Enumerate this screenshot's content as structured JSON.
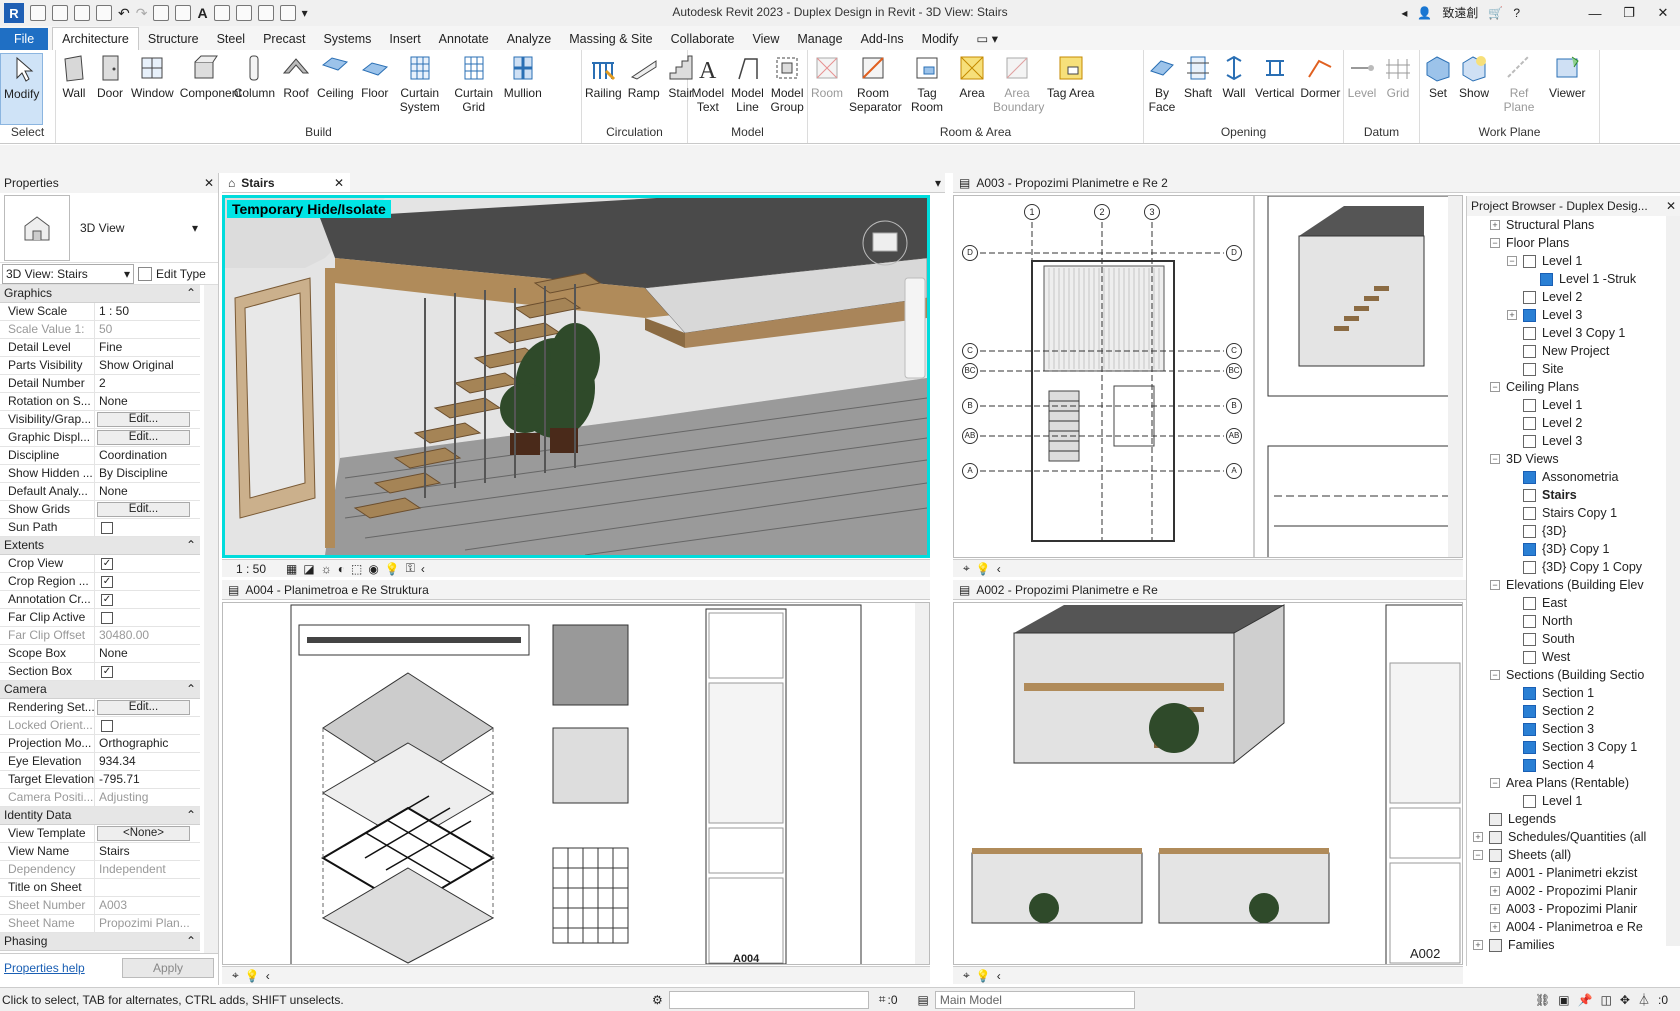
{
  "app": {
    "title": "Autodesk Revit 2023 - Duplex Design in Revit - 3D View: Stairs",
    "user": "致遠創"
  },
  "tabs": [
    "File",
    "Architecture",
    "Structure",
    "Steel",
    "Precast",
    "Systems",
    "Insert",
    "Annotate",
    "Analyze",
    "Massing & Site",
    "Collaborate",
    "View",
    "Manage",
    "Add-Ins",
    "Modify"
  ],
  "ribbon": {
    "panels": [
      {
        "label": "Select",
        "tools": [
          "Modify"
        ]
      },
      {
        "label": "Build",
        "tools": [
          "Wall",
          "Door",
          "Window",
          "Component",
          "Column",
          "Roof",
          "Ceiling",
          "Floor",
          "Curtain System",
          "Curtain Grid",
          "Mullion"
        ]
      },
      {
        "label": "Circulation",
        "tools": [
          "Railing",
          "Ramp",
          "Stair"
        ]
      },
      {
        "label": "Model",
        "tools": [
          "Model Text",
          "Model Line",
          "Model Group"
        ]
      },
      {
        "label": "Room & Area",
        "tools": [
          "Room",
          "Room Separator",
          "Tag Room",
          "Area",
          "Area Boundary",
          "Tag Area"
        ]
      },
      {
        "label": "Opening",
        "tools": [
          "By Face",
          "Shaft",
          "Wall",
          "Vertical",
          "Dormer"
        ]
      },
      {
        "label": "Datum",
        "tools": [
          "Level",
          "Grid"
        ]
      },
      {
        "label": "Work Plane",
        "tools": [
          "Set",
          "Show",
          "Ref Plane",
          "Viewer"
        ]
      }
    ]
  },
  "properties": {
    "header": "Properties",
    "type": "3D View",
    "selector": "3D View: Stairs",
    "edit_type": "Edit Type",
    "sections": [
      {
        "name": "Graphics",
        "rows": [
          [
            "View Scale",
            "1 : 50",
            ""
          ],
          [
            "Scale Value 1:",
            "50",
            "ro"
          ],
          [
            "Detail Level",
            "Fine",
            ""
          ],
          [
            "Parts Visibility",
            "Show Original",
            ""
          ],
          [
            "Detail Number",
            "2",
            ""
          ],
          [
            "Rotation on S...",
            "None",
            ""
          ],
          [
            "Visibility/Grap...",
            "Edit...",
            "btn"
          ],
          [
            "Graphic Displ...",
            "Edit...",
            "btn"
          ],
          [
            "Discipline",
            "Coordination",
            ""
          ],
          [
            "Show Hidden ...",
            "By Discipline",
            ""
          ],
          [
            "Default Analy...",
            "None",
            ""
          ],
          [
            "Show Grids",
            "Edit...",
            "btn"
          ],
          [
            "Sun Path",
            "",
            "cb0"
          ]
        ]
      },
      {
        "name": "Extents",
        "rows": [
          [
            "Crop View",
            "",
            "cb1"
          ],
          [
            "Crop Region ...",
            "",
            "cb1"
          ],
          [
            "Annotation Cr...",
            "",
            "cb1"
          ],
          [
            "Far Clip Active",
            "",
            "cb0"
          ],
          [
            "Far Clip Offset",
            "30480.00",
            "ro"
          ],
          [
            "Scope Box",
            "None",
            ""
          ],
          [
            "Section Box",
            "",
            "cb1"
          ]
        ]
      },
      {
        "name": "Camera",
        "rows": [
          [
            "Rendering Set...",
            "Edit...",
            "btn"
          ],
          [
            "Locked Orient...",
            "",
            "cb0ro"
          ],
          [
            "Projection Mo...",
            "Orthographic",
            ""
          ],
          [
            "Eye Elevation",
            "934.34",
            ""
          ],
          [
            "Target Elevation",
            "-795.71",
            ""
          ],
          [
            "Camera Positi...",
            "Adjusting",
            "ro"
          ]
        ]
      },
      {
        "name": "Identity Data",
        "rows": [
          [
            "View Template",
            "<None>",
            "btn"
          ],
          [
            "View Name",
            "Stairs",
            ""
          ],
          [
            "Dependency",
            "Independent",
            "ro"
          ],
          [
            "Title on Sheet",
            "",
            ""
          ],
          [
            "Sheet Number",
            "A003",
            "ro"
          ],
          [
            "Sheet Name",
            "Propozimi Plan...",
            "ro"
          ]
        ]
      },
      {
        "name": "Phasing",
        "rows": []
      }
    ],
    "help": "Properties help",
    "apply": "Apply"
  },
  "views": {
    "v1": {
      "tab": "Stairs",
      "banner": "Temporary Hide/Isolate",
      "scale": "1 : 50"
    },
    "v2": {
      "tab": "A003 - Propozimi Planimetre e Re 2"
    },
    "v3": {
      "tab": "A004 - Planimetroa e Re Struktura",
      "sheet": "A004"
    },
    "v4": {
      "tab": "A002 - Propozimi Planimetre e Re",
      "sheet": "A002"
    }
  },
  "grid_labels": {
    "cols": [
      "1",
      "2",
      "3"
    ],
    "rows": [
      "D",
      "C",
      "BC",
      "B",
      "AB",
      "A"
    ]
  },
  "browser": {
    "title": "Project Browser - Duplex Desig...",
    "items": [
      [
        1,
        "+",
        "",
        "Structural Plans"
      ],
      [
        1,
        "-",
        "",
        "Floor Plans"
      ],
      [
        2,
        "-",
        "w",
        "Level 1"
      ],
      [
        3,
        "",
        "b",
        "Level 1 -Struk"
      ],
      [
        2,
        "",
        "w",
        "Level 2"
      ],
      [
        2,
        "+",
        "b",
        "Level 3"
      ],
      [
        2,
        "",
        "w",
        "Level 3 Copy 1"
      ],
      [
        2,
        "",
        "w",
        "New Project"
      ],
      [
        2,
        "",
        "w",
        "Site"
      ],
      [
        1,
        "-",
        "",
        "Ceiling Plans"
      ],
      [
        2,
        "",
        "w",
        "Level 1"
      ],
      [
        2,
        "",
        "w",
        "Level 2"
      ],
      [
        2,
        "",
        "w",
        "Level 3"
      ],
      [
        1,
        "-",
        "",
        "3D Views"
      ],
      [
        2,
        "",
        "b",
        "Assonometria"
      ],
      [
        2,
        "",
        "w",
        "Stairs"
      ],
      [
        2,
        "",
        "w",
        "Stairs Copy 1"
      ],
      [
        2,
        "",
        "w",
        "{3D}"
      ],
      [
        2,
        "",
        "b",
        "{3D} Copy 1"
      ],
      [
        2,
        "",
        "w",
        "{3D} Copy 1 Copy"
      ],
      [
        1,
        "-",
        "",
        "Elevations (Building Elev"
      ],
      [
        2,
        "",
        "w",
        "East"
      ],
      [
        2,
        "",
        "w",
        "North"
      ],
      [
        2,
        "",
        "w",
        "South"
      ],
      [
        2,
        "",
        "w",
        "West"
      ],
      [
        1,
        "-",
        "",
        "Sections (Building Sectio"
      ],
      [
        2,
        "",
        "b",
        "Section 1"
      ],
      [
        2,
        "",
        "b",
        "Section 2"
      ],
      [
        2,
        "",
        "b",
        "Section 3"
      ],
      [
        2,
        "",
        "b",
        "Section 3 Copy 1"
      ],
      [
        2,
        "",
        "b",
        "Section 4"
      ],
      [
        1,
        "-",
        "",
        "Area Plans (Rentable)"
      ],
      [
        2,
        "",
        "w",
        "Level 1"
      ],
      [
        0,
        "",
        "leg",
        "Legends"
      ],
      [
        0,
        "+",
        "sch",
        "Schedules/Quantities (all"
      ],
      [
        0,
        "-",
        "sh",
        "Sheets (all)"
      ],
      [
        1,
        "+",
        "",
        "A001 - Planimetri ekzist"
      ],
      [
        1,
        "+",
        "",
        "A002 - Propozimi Planir"
      ],
      [
        1,
        "+",
        "",
        "A003 - Propozimi Planir"
      ],
      [
        1,
        "+",
        "",
        "A004 - Planimetroa e Re"
      ],
      [
        0,
        "+",
        "fam",
        "Families"
      ]
    ]
  },
  "status": {
    "hint": "Click to select, TAB for alternates, CTRL adds, SHIFT unselects.",
    "zero": ":0",
    "model": "Main Model",
    "filter": ":0"
  }
}
